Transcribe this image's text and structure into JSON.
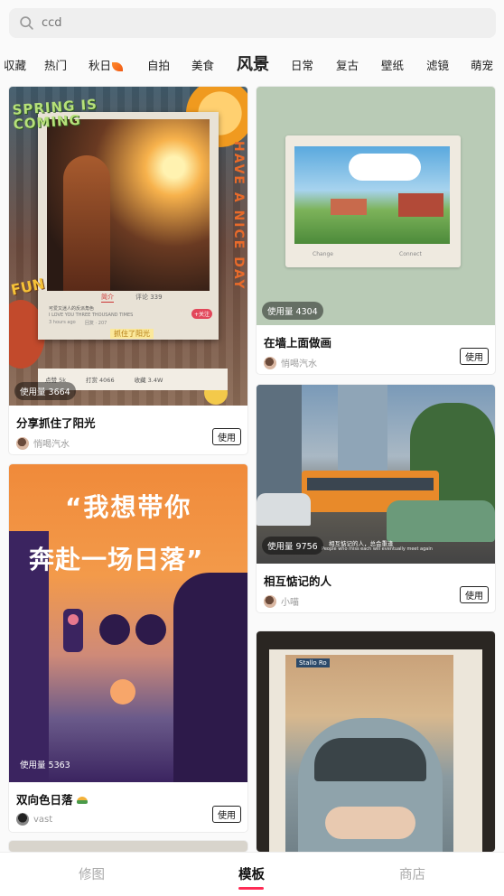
{
  "search": {
    "placeholder": "ccd"
  },
  "tabs": [
    "収藏",
    "热门",
    "秋日",
    "自拍",
    "美食",
    "风景",
    "日常",
    "复古",
    "壁纸",
    "滤镜",
    "萌宠"
  ],
  "active_tab": "风景",
  "use_label": "使用",
  "cards": [
    {
      "usage": "使用量 3664",
      "title": "分享抓住了阳光",
      "author": "悄喝汽水",
      "overlay": {
        "headline": "SPRING IS COMING",
        "side_text": "HAVE A NICE DAY",
        "fun": "FUN",
        "tab_a": "简介",
        "tab_b": "评论 339",
        "follow": "+关注",
        "chip": "抓住了阳光",
        "likes": "点赞 5k",
        "views": "打赏 4066",
        "collects": "收藏 3.4W",
        "line1": "可爱又迷人的反派角色",
        "line2": "I LOVE YOU THREE THOUSAND TIMES",
        "line3": "3 hours ago",
        "line4": "回复 · 207"
      }
    },
    {
      "usage": "使用量 4304",
      "title": "在墙上面做画",
      "author": "悄喝汽水",
      "overlay": {
        "left_caption": "Change",
        "right_caption": "Connect"
      }
    },
    {
      "usage": "使用量 9756",
      "title": "相互惦记的人",
      "author": "小喵",
      "overlay": {
        "caption": "相互惦记的人，总会重逢",
        "sub_caption": "People who miss each will eventually meet again"
      }
    },
    {
      "usage": "使用量 5363",
      "title": "双向色日落",
      "author": "vast",
      "overlay": {
        "calligraphy_1": "“我想带你",
        "calligraphy_2": "奔赴一场日落”"
      }
    },
    {
      "usage": "",
      "title": "",
      "author": "",
      "overlay": {
        "sign": "Stallo Ro"
      }
    }
  ],
  "bottom_nav": [
    {
      "label": "修图",
      "active": false
    },
    {
      "label": "模板",
      "active": true
    },
    {
      "label": "商店",
      "active": false
    }
  ],
  "colors": {
    "accent": "#ff2b55",
    "sunset_orange": "#f0883a",
    "sunset_purple": "#3b2460"
  }
}
